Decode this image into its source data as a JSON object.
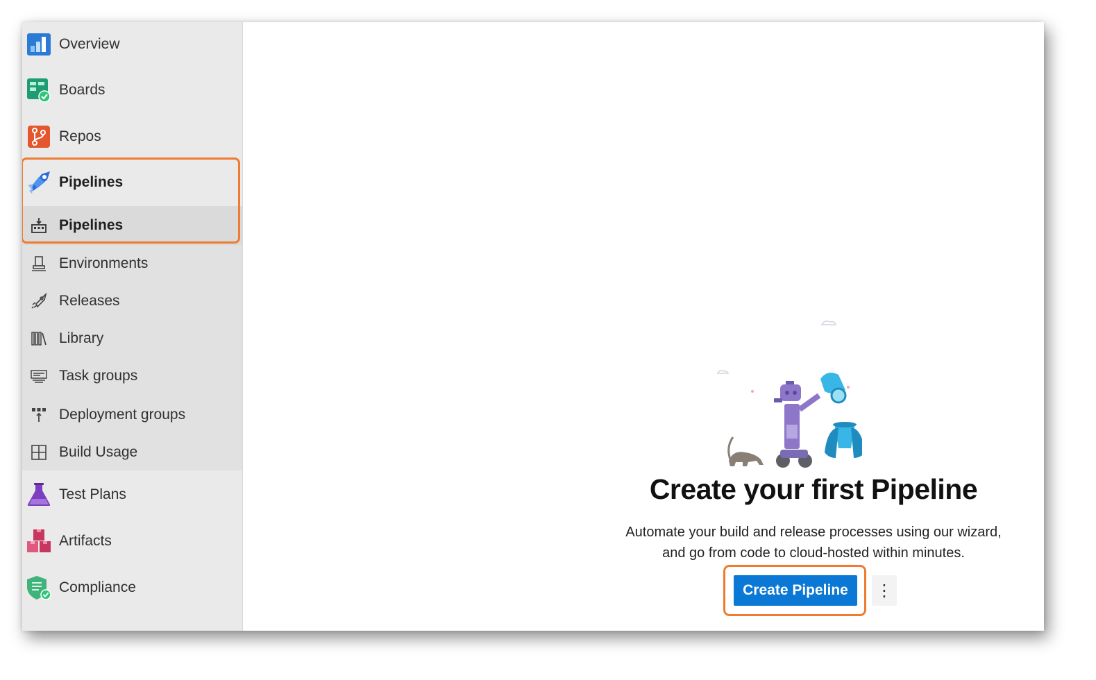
{
  "sidebar": {
    "items": [
      {
        "label": "Overview",
        "icon": "overview-icon"
      },
      {
        "label": "Boards",
        "icon": "boards-icon"
      },
      {
        "label": "Repos",
        "icon": "repos-icon"
      },
      {
        "label": "Pipelines",
        "icon": "pipelines-icon"
      },
      {
        "label": "Test Plans",
        "icon": "test-plans-icon"
      },
      {
        "label": "Artifacts",
        "icon": "artifacts-icon"
      },
      {
        "label": "Compliance",
        "icon": "compliance-icon"
      }
    ],
    "pipelines_sub": [
      {
        "label": "Pipelines",
        "icon": "pipelines-sub-icon"
      },
      {
        "label": "Environments",
        "icon": "environments-icon"
      },
      {
        "label": "Releases",
        "icon": "releases-icon"
      },
      {
        "label": "Library",
        "icon": "library-icon"
      },
      {
        "label": "Task groups",
        "icon": "task-groups-icon"
      },
      {
        "label": "Deployment groups",
        "icon": "deployment-groups-icon"
      },
      {
        "label": "Build Usage",
        "icon": "build-usage-icon"
      }
    ]
  },
  "main": {
    "title": "Create your first Pipeline",
    "description_line1": "Automate your build and release processes using our wizard,",
    "description_line2": "and go from code to cloud-hosted within minutes.",
    "create_button": "Create Pipeline",
    "more_button": "⋮"
  },
  "colors": {
    "accent": "#0a78d4",
    "highlight": "#ee7b30",
    "sidebar_bg": "#eaeaea"
  }
}
